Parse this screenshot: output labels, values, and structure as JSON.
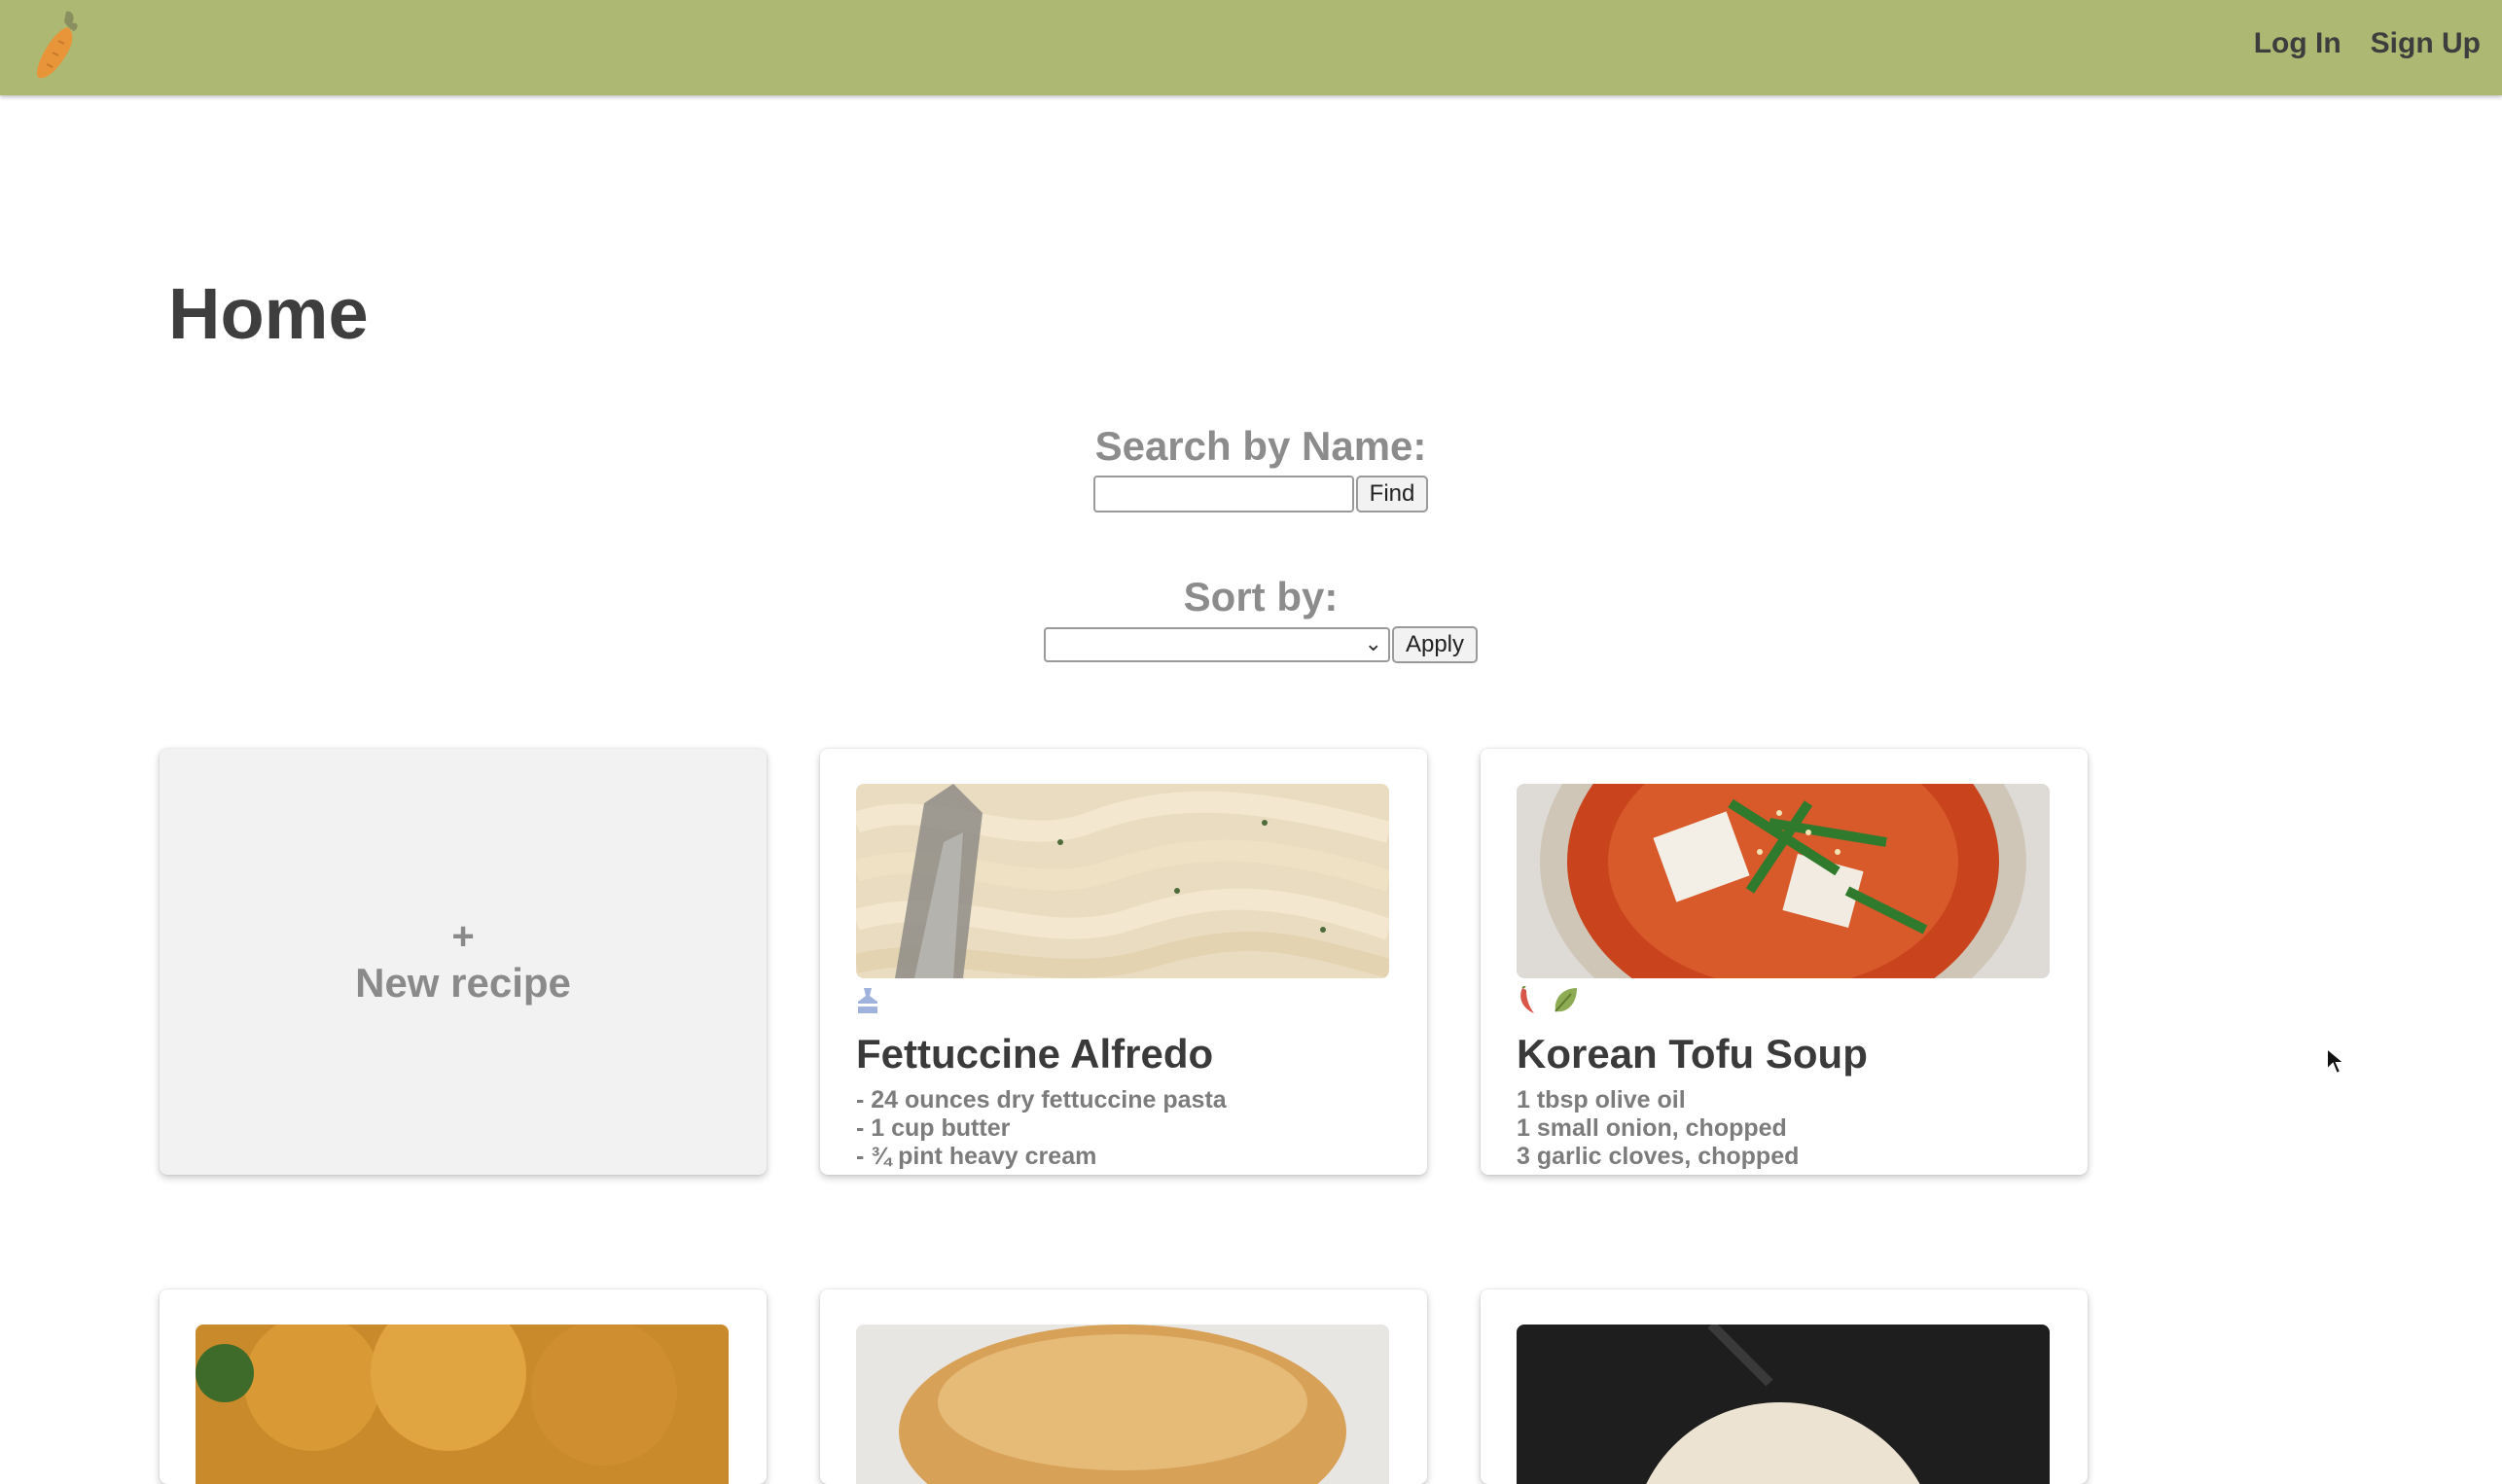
{
  "nav": {
    "login_label": "Log In",
    "signup_label": "Sign Up"
  },
  "page": {
    "title": "Home"
  },
  "search": {
    "label": "Search by Name:",
    "value": "",
    "button_label": "Find"
  },
  "sort": {
    "label": "Sort by:",
    "selected": "",
    "button_label": "Apply"
  },
  "new_recipe": {
    "plus": "+",
    "label": "New recipe"
  },
  "recipes": [
    {
      "title": "Fettuccine Alfredo",
      "tags": [
        "dairy-icon"
      ],
      "ingredients": [
        "- 24 ounces dry fettuccine pasta",
        "- 1 cup butter",
        "- ¾ pint heavy cream"
      ]
    },
    {
      "title": "Korean Tofu Soup",
      "tags": [
        "chili-pepper-icon",
        "leaf-icon"
      ],
      "ingredients": [
        "1 tbsp olive oil",
        "1 small onion, chopped",
        "3 garlic cloves, chopped"
      ]
    }
  ],
  "colors": {
    "topbar": "#adb872",
    "card_bg": "#f2f2f2",
    "muted_text": "#8c8c8c"
  }
}
